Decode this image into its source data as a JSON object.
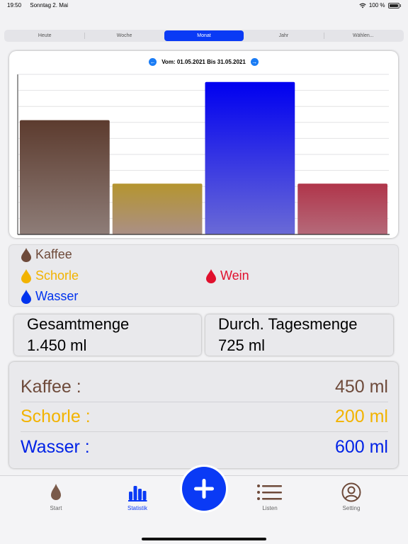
{
  "status": {
    "time": "19:50",
    "date": "Sonntag 2. Mai",
    "battery": "100 %"
  },
  "periods": [
    {
      "label": "Heute",
      "active": false
    },
    {
      "label": "Woche",
      "active": false
    },
    {
      "label": "Monat",
      "active": true
    },
    {
      "label": "Jahr",
      "active": false
    },
    {
      "label": "Wählen...",
      "active": false
    }
  ],
  "chart_header": {
    "range_text": "Vom: 01.05.2021 Bis 31.05.2021"
  },
  "chart_data": {
    "type": "bar",
    "categories": [
      "Kaffee",
      "Schorle",
      "Wasser",
      "Wein"
    ],
    "values": [
      450,
      200,
      600,
      200
    ],
    "colors": [
      "#5c3b2e",
      "#b5952f",
      "#0000f0",
      "#b0354a"
    ],
    "ylim": [
      0,
      630
    ],
    "grid": true
  },
  "legend": {
    "kaffee": {
      "label": "Kaffee",
      "color": "#6e4a3a"
    },
    "schorle": {
      "label": "Schorle",
      "color": "#f2b300"
    },
    "wasser": {
      "label": "Wasser",
      "color": "#0033ee"
    },
    "wein": {
      "label": "Wein",
      "color": "#e0102d"
    }
  },
  "summary": {
    "total_label": "Gesamtmenge",
    "total_value": "1.450 ml",
    "daily_label": "Durch. Tagesmenge",
    "daily_value": "725 ml"
  },
  "totals": [
    {
      "name": "Kaffee :",
      "value": "450 ml",
      "color": "#6e4a3a"
    },
    {
      "name": "Schorle :",
      "value": "200 ml",
      "color": "#f2b300"
    },
    {
      "name": "Wasser :",
      "value": "600 ml",
      "color": "#0022e6"
    }
  ],
  "tabs": {
    "start": "Start",
    "statistik": "Statistik",
    "listen": "Listen",
    "setting": "Setting"
  },
  "colors": {
    "accent": "#0a3af5",
    "brown": "#6e4a3a",
    "nav_arrow": "#1a7cf5"
  }
}
